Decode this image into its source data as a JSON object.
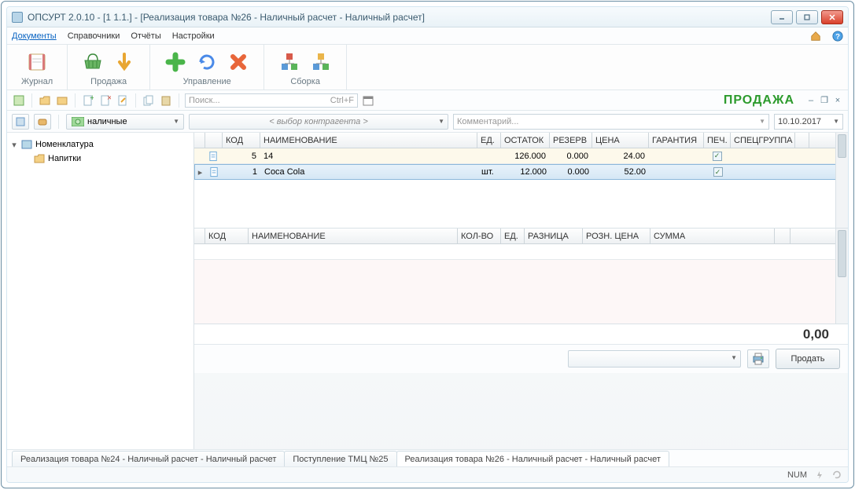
{
  "window": {
    "title": "ОПСУРТ  2.0.10 - [1 1.1.] - [Реализация товара №26 - Наличный расчет - Наличный расчет]"
  },
  "menu": {
    "documents": "Документы",
    "catalogs": "Справочники",
    "reports": "Отчёты",
    "settings": "Настройки"
  },
  "ribbon": {
    "journal": "Журнал",
    "sale": "Продажа",
    "management": "Управление",
    "assembly": "Сборка"
  },
  "secondary": {
    "search_placeholder": "Поиск...",
    "search_shortcut": "Ctrl+F",
    "mode_label": "ПРОДАЖА"
  },
  "filter": {
    "payment_type": "наличные",
    "counterparty_placeholder": "< выбор контрагента >",
    "comment_placeholder": "Комментарий...",
    "date": "10.10.2017"
  },
  "tree": {
    "root": "Номенклатура",
    "child1": "Напитки"
  },
  "grid_top": {
    "headers": {
      "code": "КОД",
      "name": "НАИМЕНОВАНИЕ",
      "unit": "ЕД.",
      "stock": "ОСТАТОК",
      "reserve": "РЕЗЕРВ",
      "price": "ЦЕНА",
      "warranty": "ГАРАНТИЯ",
      "print": "ПЕЧ.",
      "spec": "СПЕЦГРУППА"
    },
    "rows": [
      {
        "code": "5",
        "name": "14",
        "unit": "",
        "stock": "126.000",
        "reserve": "0.000",
        "price": "24.00",
        "print": true
      },
      {
        "code": "1",
        "name": "Coca Cola",
        "unit": "шт.",
        "stock": "12.000",
        "reserve": "0.000",
        "price": "52.00",
        "print": true
      }
    ]
  },
  "grid_bottom": {
    "headers": {
      "code": "КОД",
      "name": "НАИМЕНОВАНИЕ",
      "qty": "КОЛ-ВО",
      "unit": "ЕД.",
      "diff": "РАЗНИЦА",
      "rprice": "РОЗН. ЦЕНА",
      "sum": "СУММА"
    }
  },
  "total": "0,00",
  "actions": {
    "sell": "Продать"
  },
  "tabs": {
    "t1": "Реализация товара №24 - Наличный расчет - Наличный расчет",
    "t2": "Поступление ТМЦ №25",
    "t3": "Реализация товара №26 - Наличный расчет - Наличный расчет"
  },
  "status": {
    "num": "NUM"
  }
}
